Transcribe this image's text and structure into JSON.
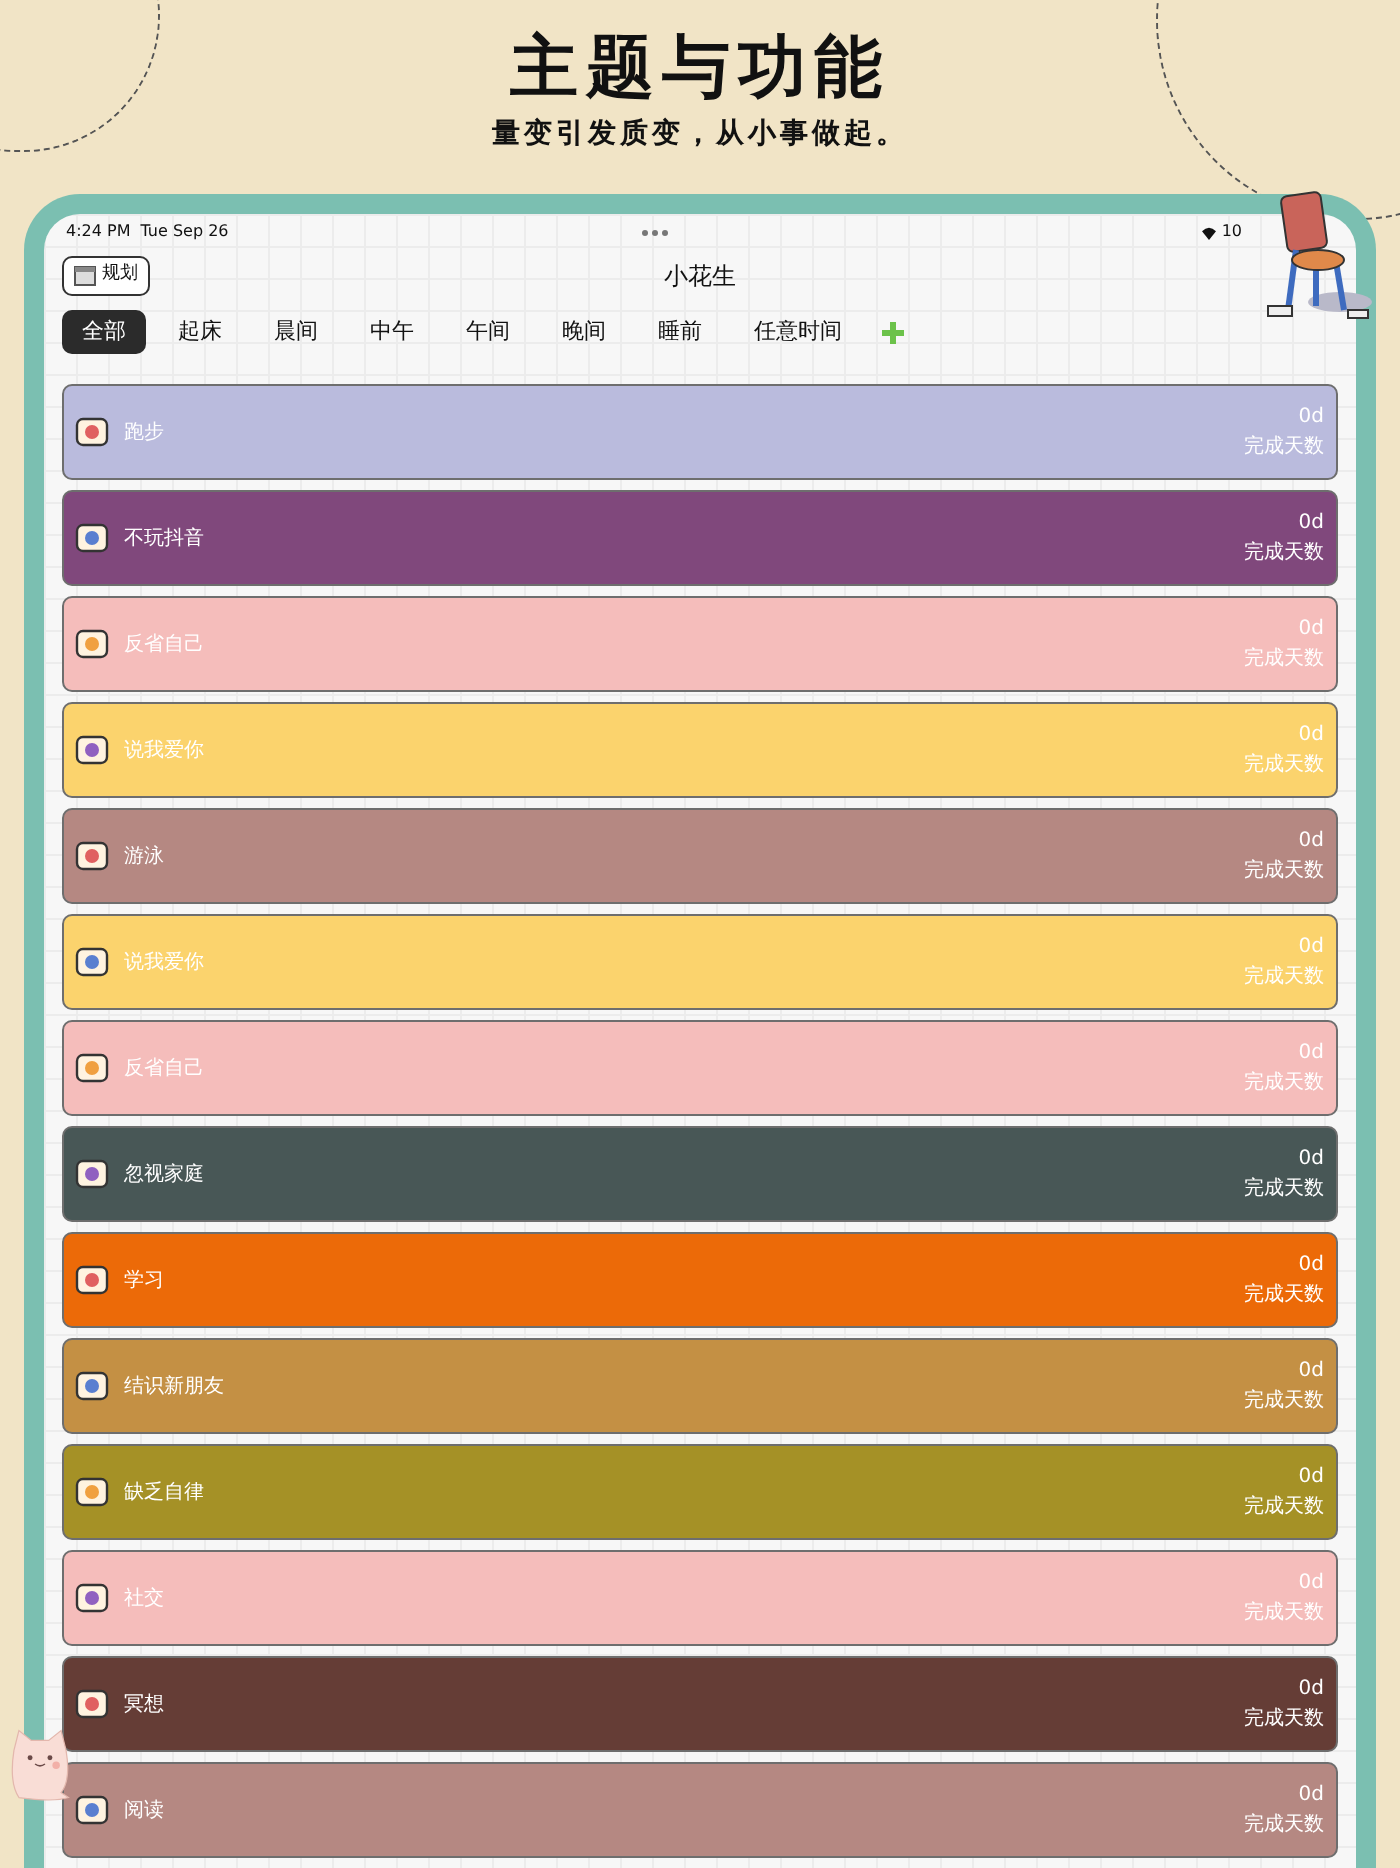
{
  "headline": "主题与功能",
  "subtitle": "量变引发质变，从小事做起。",
  "status_bar": {
    "time": "4:24 PM",
    "date": "Tue Sep 26",
    "battery": "10"
  },
  "nav": {
    "plan_button": "规划",
    "title": "小花生"
  },
  "tabs": [
    {
      "label": "全部",
      "selected": true
    },
    {
      "label": "起床",
      "selected": false
    },
    {
      "label": "晨间",
      "selected": false
    },
    {
      "label": "中午",
      "selected": false
    },
    {
      "label": "午间",
      "selected": false
    },
    {
      "label": "晚间",
      "selected": false
    },
    {
      "label": "睡前",
      "selected": false
    },
    {
      "label": "任意时间",
      "selected": false
    }
  ],
  "habits": [
    {
      "name": "跑步",
      "days": "0d",
      "caption": "完成天数",
      "color": "#babbdd"
    },
    {
      "name": "不玩抖音",
      "days": "0d",
      "caption": "完成天数",
      "color": "#80487c"
    },
    {
      "name": "反省自己",
      "days": "0d",
      "caption": "完成天数",
      "color": "#f5bdbb"
    },
    {
      "name": "说我爱你",
      "days": "0d",
      "caption": "完成天数",
      "color": "#fbd36d"
    },
    {
      "name": "游泳",
      "days": "0d",
      "caption": "完成天数",
      "color": "#b58882"
    },
    {
      "name": "说我爱你",
      "days": "0d",
      "caption": "完成天数",
      "color": "#fbd36d"
    },
    {
      "name": "反省自己",
      "days": "0d",
      "caption": "完成天数",
      "color": "#f5bdbb"
    },
    {
      "name": "忽视家庭",
      "days": "0d",
      "caption": "完成天数",
      "color": "#485756"
    },
    {
      "name": "学习",
      "days": "0d",
      "caption": "完成天数",
      "color": "#ec6a08"
    },
    {
      "name": "结识新朋友",
      "days": "0d",
      "caption": "完成天数",
      "color": "#c49044"
    },
    {
      "name": "缺乏自律",
      "days": "0d",
      "caption": "完成天数",
      "color": "#a59126"
    },
    {
      "name": "社交",
      "days": "0d",
      "caption": "完成天数",
      "color": "#f5bdbb"
    },
    {
      "name": "冥想",
      "days": "0d",
      "caption": "完成天数",
      "color": "#653d36"
    },
    {
      "name": "阅读",
      "days": "0d",
      "caption": "完成天数",
      "color": "#b58882"
    }
  ]
}
